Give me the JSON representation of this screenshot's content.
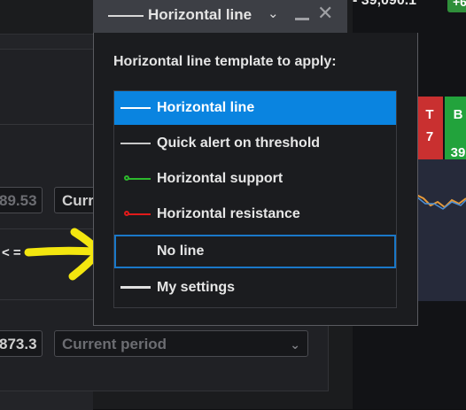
{
  "background": {
    "ticker_value": "- 39,090.1",
    "ticker_change": "+6",
    "price_field": "89.53",
    "period_field": "Curr",
    "condition_label": "< =",
    "value_field": "873.3",
    "period_select": "Current period",
    "tile_red_letter": "T",
    "tile_red_number": "7",
    "tile_green_letter": "B",
    "tile_green_number": "39"
  },
  "dialog": {
    "header_title": "Horizontal line",
    "body_title": "Horizontal line template to apply:",
    "items": [
      {
        "label": "Horizontal line",
        "swatch": "line",
        "color": "#ffffff"
      },
      {
        "label": "Quick alert on threshold",
        "swatch": "line",
        "color": "#c8c8c8"
      },
      {
        "label": "Horizontal support",
        "swatch": "dot-line",
        "color": "#2db82d"
      },
      {
        "label": "Horizontal resistance",
        "swatch": "dot-line",
        "color": "#e01a1a"
      },
      {
        "label": "No line",
        "swatch": "none",
        "color": ""
      },
      {
        "label": "My settings",
        "swatch": "thick-line",
        "color": "#e0e0e0"
      }
    ],
    "selected_index": 0,
    "focused_index": 4,
    "colors": {
      "selection": "#0a84e0",
      "focus_border": "#1a78c8",
      "annotation_arrow": "#f3e60f"
    }
  }
}
